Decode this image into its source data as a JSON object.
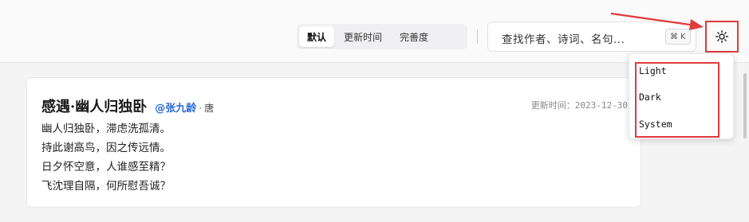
{
  "sort": {
    "options": [
      {
        "label": "默认",
        "active": true
      },
      {
        "label": "更新时间",
        "active": false
      },
      {
        "label": "完善度",
        "active": false
      }
    ]
  },
  "search": {
    "placeholder": "查找作者、诗词、名句...",
    "shortcut_symbol": "⌘",
    "shortcut_key": "K"
  },
  "theme": {
    "icon": "sun-icon",
    "menu": [
      "Light",
      "Dark",
      "System"
    ]
  },
  "poem": {
    "title": "感遇·幽人归独卧",
    "author": "@张九龄",
    "separator": "·",
    "dynasty": "唐",
    "update_label": "更新时间：",
    "update_date": "2023-12-30",
    "lines": [
      "幽人归独卧，滞虑洗孤清。",
      "持此谢高鸟，因之传远情。",
      "日夕怀空意，人谁感至精？",
      "飞沈理自隔，何所慰吾诚？"
    ]
  },
  "colors": {
    "annotation_red": "#e03b3b",
    "author_link": "#2a6ad6"
  }
}
